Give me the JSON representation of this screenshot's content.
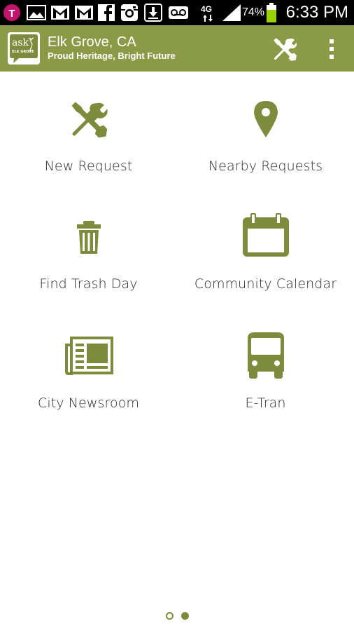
{
  "status_bar": {
    "carrier_icon": "t-mobile-icon",
    "network": "4G",
    "battery": "74%",
    "time": "6:33 PM",
    "icons": [
      "photo-icon",
      "gmail-icon",
      "gmail-icon",
      "facebook-icon",
      "instagram-icon",
      "download-icon",
      "voicemail-icon",
      "signal-icon",
      "battery-icon"
    ]
  },
  "app_bar": {
    "logo_text": "ask",
    "logo_subtext": "ELK GROVE",
    "title": "Elk Grove, CA",
    "subtitle": "Proud Heritage, Bright Future",
    "settings_icon": "tools-icon",
    "menu_icon": "overflow-menu-icon"
  },
  "menu": {
    "items": [
      {
        "label": "New Request",
        "icon": "tools-icon"
      },
      {
        "label": "Nearby Requests",
        "icon": "map-pin-icon"
      },
      {
        "label": "Find Trash Day",
        "icon": "trash-can-icon"
      },
      {
        "label": "Community Calendar",
        "icon": "calendar-icon"
      },
      {
        "label": "City Newsroom",
        "icon": "newspaper-icon"
      },
      {
        "label": "E-Tran",
        "icon": "bus-icon"
      }
    ]
  },
  "pager": {
    "pages": 2,
    "current_page": 2
  },
  "colors": {
    "accent": "#8b9a46",
    "icon": "#7d8c3c",
    "text": "#2a2a2a",
    "status_bar": "#000000"
  }
}
